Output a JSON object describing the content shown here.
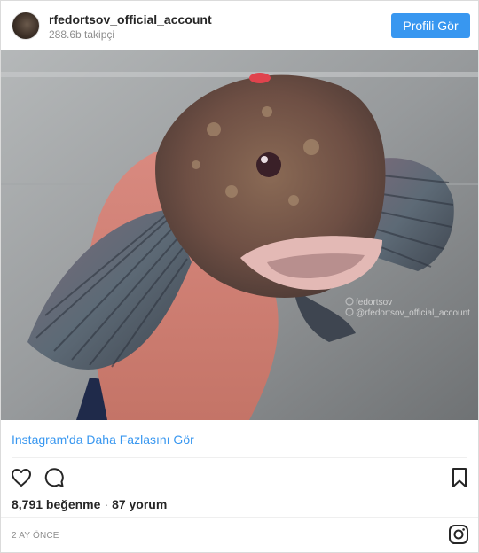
{
  "header": {
    "username": "rfedortsov_official_account",
    "followers": "288.6b takipçi",
    "profile_button": "Profili Gör"
  },
  "post": {
    "watermark_line1": "fedortsov",
    "watermark_line2": "@rfedortsov_official_account",
    "more_link": "Instagram'da Daha Fazlasını Gör",
    "likes": "8,791 beğenme",
    "separator": "·",
    "comments": "87 yorum",
    "timestamp": "2 AY ÖNCE"
  },
  "icons": {
    "like": "heart-icon",
    "comment": "comment-icon",
    "save": "bookmark-icon",
    "brand": "instagram-icon"
  },
  "colors": {
    "accent": "#3897f0",
    "text": "#262626",
    "muted": "#8e8e8e"
  }
}
